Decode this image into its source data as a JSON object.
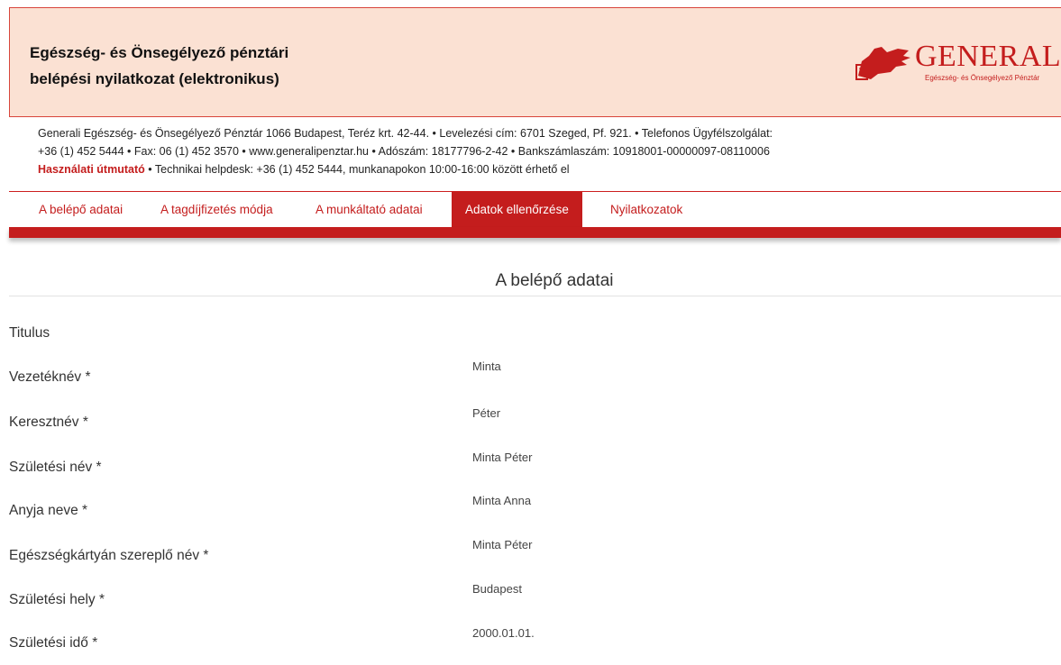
{
  "header": {
    "title_line1": "Egészség- és Önsegélyező pénztári",
    "title_line2": "belépési nyilatkozat (elektronikus)",
    "logo_text": "GENERALI",
    "logo_subtext": "Egészség- és Önsegélyező Pénztár"
  },
  "info": {
    "line1": "Generali Egészség- és Önsegélyező Pénztár 1066 Budapest, Teréz krt. 42-44. • Levelezési cím: 6701 Szeged, Pf. 921. • Telefonos Ügyfélszolgálat:",
    "line2": "+36 (1) 452 5444 • Fax: 06 (1) 452 3570 • www.generalipenztar.hu • Adószám: 18177796-2-42 • Bankszámlaszám: 10918001-00000097-08110006",
    "help_link": "Használati útmutató",
    "helpdesk": " • Technikai helpdesk: +36 (1) 452 5444, munkanapokon 10:00-16:00 között érhető el"
  },
  "nav": {
    "tabs": [
      {
        "label": "A belépő adatai"
      },
      {
        "label": "A tagdíjfizetés módja"
      },
      {
        "label": "A munkáltató adatai"
      },
      {
        "label": "Adatok ellenőrzése"
      },
      {
        "label": "Nyilatkozatok"
      }
    ],
    "active_tab": "Adatok ellenőrzése"
  },
  "section": {
    "title": "A belépő adatai",
    "fields": [
      {
        "label": "Titulus",
        "value": ""
      },
      {
        "label": "Vezetéknév *",
        "value": "Minta"
      },
      {
        "label": "Keresztnév *",
        "value": "Péter"
      },
      {
        "label": "Születési név *",
        "value": "Minta Péter"
      },
      {
        "label": "Anyja neve *",
        "value": "Minta Anna"
      },
      {
        "label": "Egészségkártyán szereplő név *",
        "value": "Minta Péter"
      },
      {
        "label": "Születési hely *",
        "value": "Budapest"
      },
      {
        "label": "Születési idő *",
        "value": "2000.01.01."
      }
    ]
  },
  "colors": {
    "brand_red": "#c41d1d",
    "header_bg": "#fbe1d3"
  }
}
